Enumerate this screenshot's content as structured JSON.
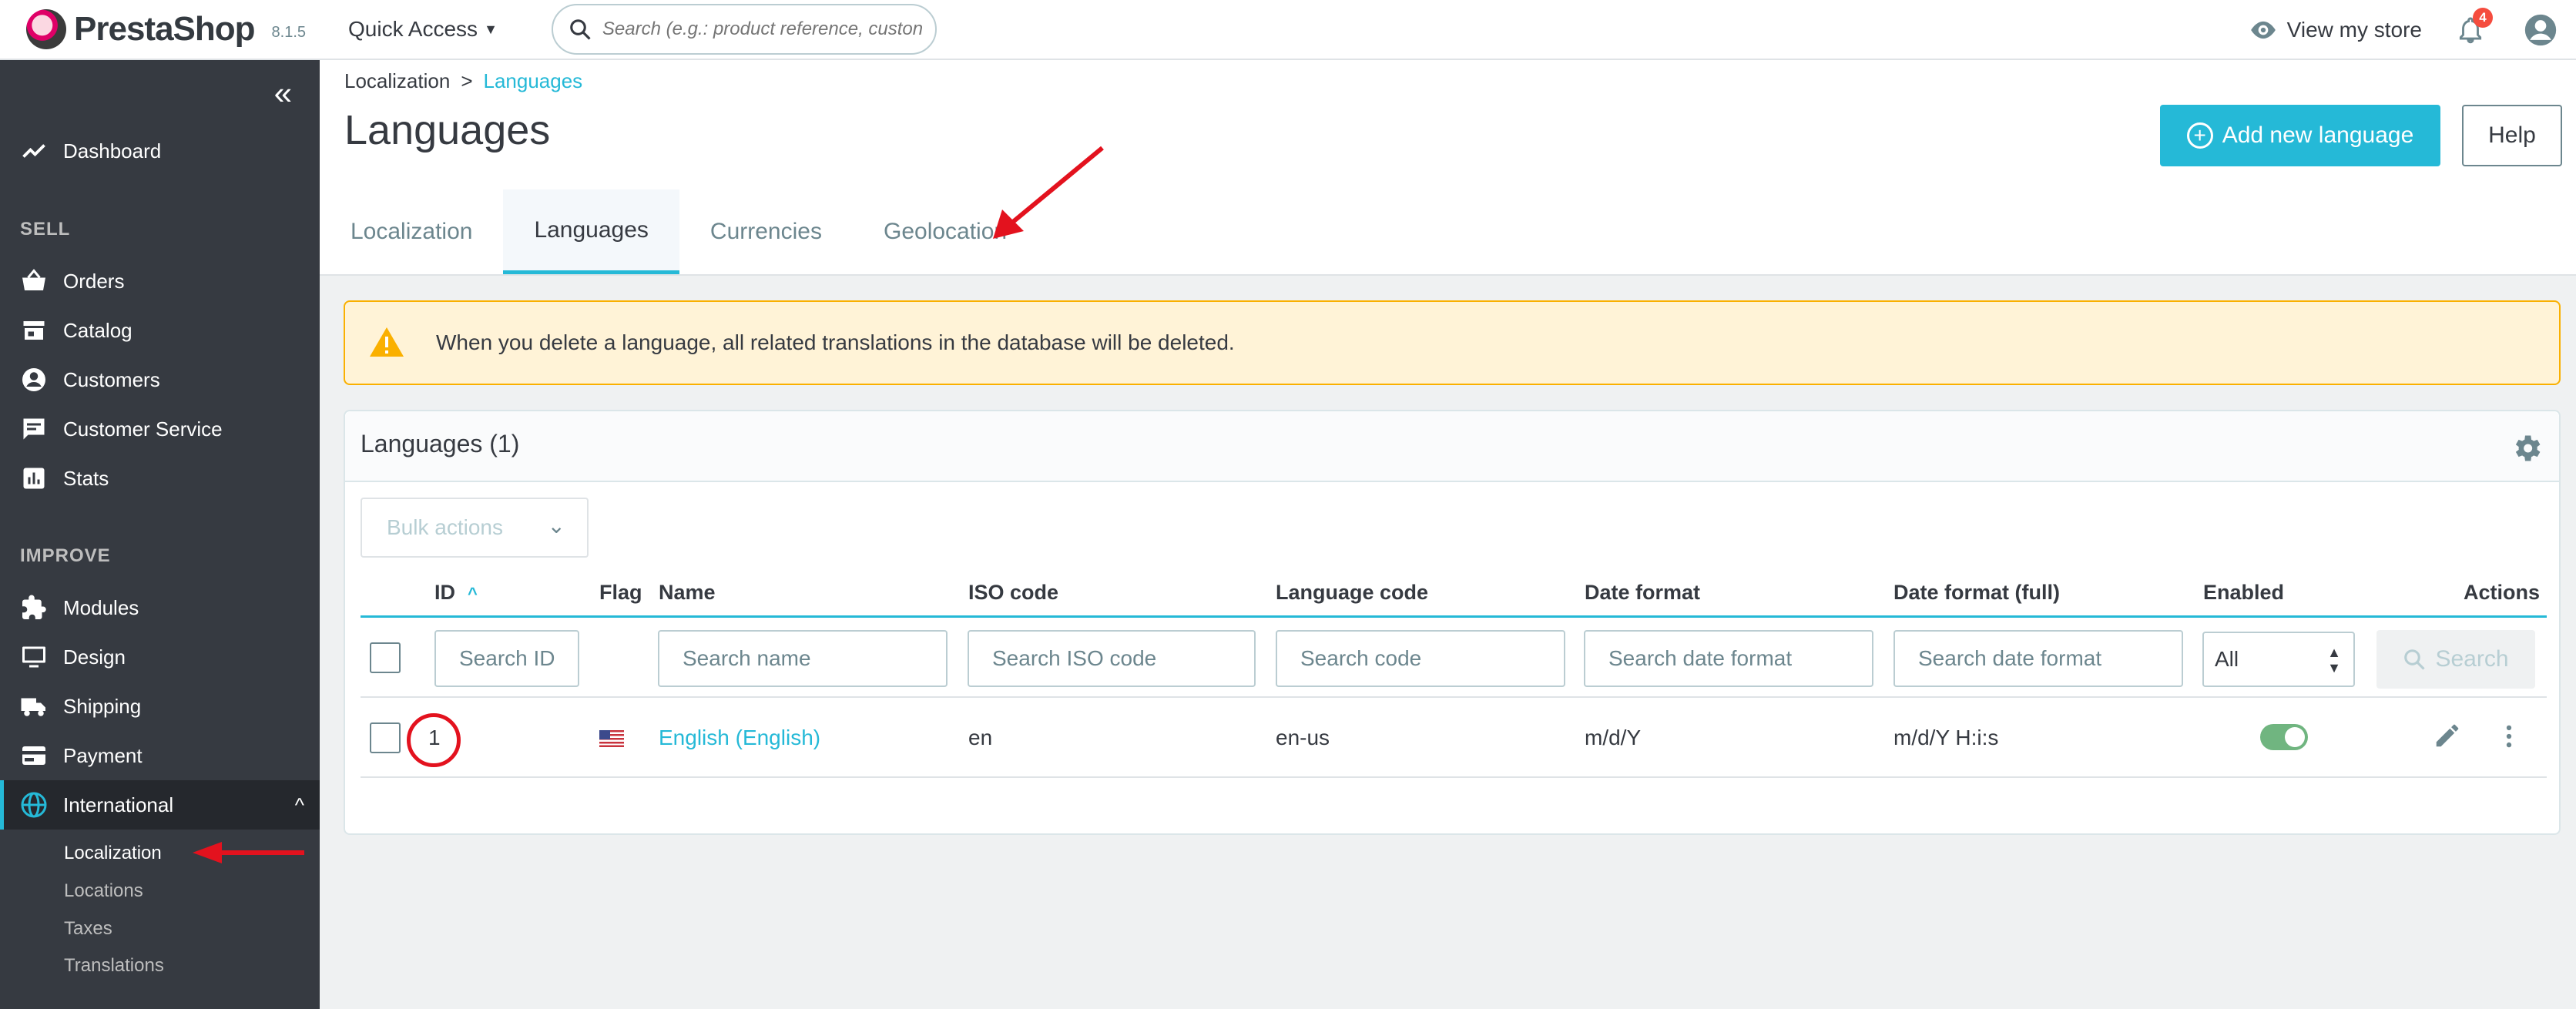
{
  "header": {
    "brand": "PrestaShop",
    "version": "8.1.5",
    "quick_access": "Quick Access",
    "search_placeholder": "Search (e.g.: product reference, custon",
    "view_store": "View my store",
    "notification_count": "4"
  },
  "sidebar": {
    "dashboard": "Dashboard",
    "section_sell": "SELL",
    "orders": "Orders",
    "catalog": "Catalog",
    "customers": "Customers",
    "customer_service": "Customer Service",
    "stats": "Stats",
    "section_improve": "IMPROVE",
    "modules": "Modules",
    "design": "Design",
    "shipping": "Shipping",
    "payment": "Payment",
    "international": "International",
    "sub_items": [
      "Localization",
      "Locations",
      "Taxes",
      "Translations"
    ]
  },
  "page": {
    "breadcrumb_parent": "Localization",
    "breadcrumb_current": "Languages",
    "title": "Languages",
    "add_button": "Add new language",
    "help_button": "Help",
    "tabs": [
      "Localization",
      "Languages",
      "Currencies",
      "Geolocation"
    ],
    "active_tab": "Languages"
  },
  "alert": {
    "text": "When you delete a language, all related translations in the database will be deleted.",
    "color": "#fab000"
  },
  "grid": {
    "title": "Languages (1)",
    "bulk_actions": "Bulk actions",
    "columns": {
      "id": "ID",
      "flag": "Flag",
      "name": "Name",
      "iso": "ISO code",
      "lang_code": "Language code",
      "date_format": "Date format",
      "date_format_full": "Date format (full)",
      "enabled": "Enabled",
      "actions": "Actions"
    },
    "filters": {
      "id": "Search ID",
      "name": "Search name",
      "iso": "Search ISO code",
      "code": "Search code",
      "date_format": "Search date format",
      "date_format_full": "Search date format",
      "enabled": "All",
      "search_button": "Search"
    },
    "rows": [
      {
        "id": "1",
        "name": "English (English)",
        "iso": "en",
        "lang_code": "en-us",
        "date_format": "m/d/Y",
        "date_format_full": "m/d/Y H:i:s",
        "enabled": true
      }
    ]
  },
  "colors": {
    "accent": "#25b9d7",
    "sidebar": "#363a41",
    "annotation": "#e3121e"
  }
}
